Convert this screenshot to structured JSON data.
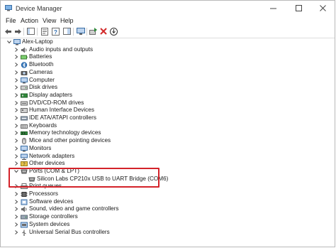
{
  "window": {
    "title": "Device Manager",
    "minimize_glyph": "—",
    "maximize_glyph": "☐",
    "close_glyph": "✕"
  },
  "menu": [
    {
      "label": "File"
    },
    {
      "label": "Action"
    },
    {
      "label": "View"
    },
    {
      "label": "Help"
    }
  ],
  "toolbar": {
    "buttons": [
      "back-icon",
      "forward-icon",
      "show-hide-console-tree-icon",
      "properties-icon",
      "help-icon",
      "action-pane-icon",
      "monitor-icon",
      "update-driver-icon",
      "disable-device-icon",
      "uninstall-device-icon"
    ]
  },
  "tree": {
    "root": {
      "label": "Alex-Laptop",
      "expanded": true
    },
    "categories": [
      {
        "label": "Audio inputs and outputs",
        "icon": "speaker-icon"
      },
      {
        "label": "Batteries",
        "icon": "battery-icon"
      },
      {
        "label": "Bluetooth",
        "icon": "bluetooth-icon"
      },
      {
        "label": "Cameras",
        "icon": "camera-icon"
      },
      {
        "label": "Computer",
        "icon": "computer-icon"
      },
      {
        "label": "Disk drives",
        "icon": "disk-drive-icon"
      },
      {
        "label": "Display adapters",
        "icon": "display-adapter-icon"
      },
      {
        "label": "DVD/CD-ROM drives",
        "icon": "dvd-drive-icon"
      },
      {
        "label": "Human Interface Devices",
        "icon": "hid-icon"
      },
      {
        "label": "IDE ATA/ATAPI controllers",
        "icon": "ide-controller-icon"
      },
      {
        "label": "Keyboards",
        "icon": "keyboard-icon"
      },
      {
        "label": "Memory technology devices",
        "icon": "memory-icon"
      },
      {
        "label": "Mice and other pointing devices",
        "icon": "mouse-icon"
      },
      {
        "label": "Monitors",
        "icon": "monitor-icon"
      },
      {
        "label": "Network adapters",
        "icon": "network-adapter-icon"
      },
      {
        "label": "Other devices",
        "icon": "other-devices-icon"
      },
      {
        "label": "Ports (COM & LPT)",
        "icon": "port-icon",
        "expanded": true,
        "children": [
          {
            "label": "Silicon Labs CP210x USB to UART Bridge (COM6)",
            "icon": "port-icon"
          }
        ]
      },
      {
        "label": "Print queues",
        "icon": "printer-icon"
      },
      {
        "label": "Processors",
        "icon": "processor-icon"
      },
      {
        "label": "Software devices",
        "icon": "software-device-icon"
      },
      {
        "label": "Sound, video and game controllers",
        "icon": "sound-icon"
      },
      {
        "label": "Storage controllers",
        "icon": "storage-controller-icon"
      },
      {
        "label": "System devices",
        "icon": "system-device-icon"
      },
      {
        "label": "Universal Serial Bus controllers",
        "icon": "usb-icon"
      }
    ]
  },
  "colors": {
    "highlight_border": "#d4232a",
    "icon_blue": "#2b6cb0",
    "icon_gray": "#6b6b6b",
    "remove_red": "#d22b2b",
    "update_green": "#2f8a3a"
  }
}
